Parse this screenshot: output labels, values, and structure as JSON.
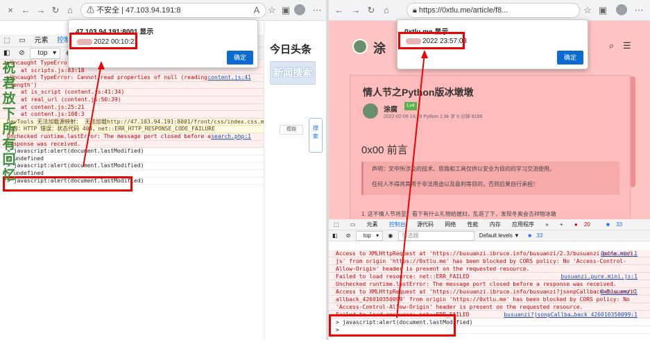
{
  "left": {
    "tab_close": "×",
    "address": "不安全 | 47.103.94.191:8",
    "address_icon": "lock-warning",
    "devtools_tabs": [
      "元素",
      "控制台"
    ],
    "context": "top",
    "dialog": {
      "title": "47.103.94.191:8001 显示",
      "message": "2022 00:10:21",
      "ok": "确定"
    },
    "page": {
      "headline": "今日头条",
      "search_button": "新闻搜索",
      "fuzzy_label": "模糊",
      "side_chars": [
        "搜",
        "索"
      ]
    },
    "console": [
      {
        "type": "error",
        "text": "▶Uncaught TypeError:",
        "indent": false
      },
      {
        "type": "error",
        "text": "at scripts.js:83:18",
        "indent": true
      },
      {
        "type": "error",
        "text": "▶Uncaught TypeError: Cannot read properties of null (reading",
        "source": "content.js:41"
      },
      {
        "type": "error",
        "text": "'length')",
        "indent": false
      },
      {
        "type": "error",
        "text": "at is_script (content.js:41:34)",
        "indent": true
      },
      {
        "type": "error",
        "text": "at real_url (content.js:50:39)",
        "indent": true
      },
      {
        "type": "error",
        "text": "at content.js:25:21",
        "indent": true
      },
      {
        "type": "error",
        "text": "at content.js:108:3",
        "indent": true
      },
      {
        "type": "warn",
        "text": "DevTools 无法加载源映射： 无法加载http://47.103.94.191:8001/front/css/index.css.map 的"
      },
      {
        "type": "warn",
        "text": "内容：HTTP 错误：状态代码 404，net::ERR_HTTP_RESPONSE_CODE_FAILURE"
      },
      {
        "type": "error",
        "text": "Unchecked runtime.lastError: The message port closed before a",
        "source": "search.php:1"
      },
      {
        "type": "error",
        "text": "response was received."
      },
      {
        "type": "plain",
        "text": "> javascript:alert(document.lastModified)"
      },
      {
        "type": "plain",
        "text": "< undefined"
      },
      {
        "type": "plain",
        "text": "> javascript:alert(document.lastModified)"
      },
      {
        "type": "plain",
        "text": "< undefined"
      },
      {
        "type": "plain",
        "text": "> javascript:alert(document.lastModified)"
      }
    ],
    "vertical_text": [
      "祝",
      "君",
      "放",
      "下",
      "所",
      "有",
      "回",
      "忆"
    ]
  },
  "right": {
    "address": "https://0xtlu.me/article/f8...",
    "site_name": "涂",
    "dialog": {
      "title": "0xtlu.me 显示",
      "message": "2022 23:57:03",
      "ok": "确定"
    },
    "article": {
      "title": "情人节之Python版冰墩墩",
      "author": "涂腐",
      "badge": "Lv4",
      "meta": "2022-02-09 14:28  Python  1.9k 字  9 分钟  8169",
      "section": "0x00 前言",
      "notice1": "声明：文中所涉及的技术、思路和工具仅供以安全为目的的学习交流使用。",
      "notice2": "任何人不得将其用于非法用途以及盈利等目的，否则后果自行承担！",
      "list1": "1. 这不情人节将至，看下有什么礼物给媳妇，乱逛了下，发现冬奥会吉祥物冰墩"
    },
    "devtools_tabs": [
      "元素",
      "控制台",
      "源代码",
      "网络",
      "性能",
      "内存",
      "应用程序"
    ],
    "error_count": "20",
    "warn_count": "33",
    "filter_placeholder": "筛选器",
    "levels": "Default levels ▼",
    "context": "top",
    "console": [
      {
        "type": "error",
        "text": "Access to XMLHttpRequest at 'https://busuanzi.ibruce.info/busuanzi/2.3/busuanzi.pure.mini.",
        "source": "0xtlu.me/:1"
      },
      {
        "type": "error",
        "text": "js' from origin 'https://0xtlu.me' has been blocked by CORS policy: No 'Access-Control-"
      },
      {
        "type": "error",
        "text": "Allow-Origin' header is present on the requested resource."
      },
      {
        "type": "error",
        "text": "Failed to load resource: net::ERR_FAILED",
        "source": "busuanzi.pure.mini.js:1"
      },
      {
        "type": "error",
        "text": "Unchecked runtime.lastError: The message port closed before a response was received."
      },
      {
        "type": "error",
        "text": "Access to XMLHttpRequest at 'https://busuanzi.ibruce.info/busuanzi?jsonpCallback=BusuanziC",
        "source": "0xtlu.me/:1"
      },
      {
        "type": "error",
        "text": "allback_426010350099' from origin 'https://0xtlu.me' has been blocked by CORS policy: No"
      },
      {
        "type": "error",
        "text": "'Access-Control-Allow-Origin' header is present on the requested resource."
      },
      {
        "type": "error",
        "text": "Failed to load resource: net::ERR_FAILED",
        "source": "busuanzi?jsonpCallba…back_426010350099:1"
      },
      {
        "type": "plain",
        "text": "> javascript:alert(document.lastModified)"
      },
      {
        "type": "plain",
        "text": ">"
      }
    ]
  }
}
